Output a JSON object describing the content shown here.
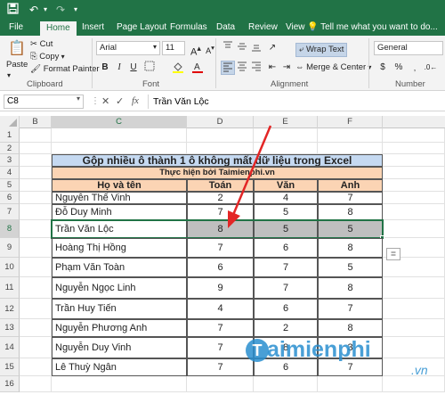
{
  "quick_access": {
    "save_icon": "save-icon",
    "undo_icon": "undo-icon",
    "redo_icon": "redo-icon"
  },
  "tabs": [
    "File",
    "Home",
    "Insert",
    "Page Layout",
    "Formulas",
    "Data",
    "Review",
    "View"
  ],
  "tell_me": "Tell me what you want to do...",
  "ribbon": {
    "paste": "Paste",
    "cut": "Cut",
    "copy": "Copy",
    "format_painter": "Format Painter",
    "clipboard_label": "Clipboard",
    "font_name": "Arial",
    "font_size": "11",
    "font_label": "Font",
    "bold": "B",
    "italic": "I",
    "underline": "U",
    "wrap_text": "Wrap Text",
    "merge_center": "Merge & Center",
    "alignment_label": "Alignment",
    "number_format": "General",
    "currency": "$",
    "percent": "%",
    "number_label": "Number"
  },
  "formula_bar": {
    "name_box": "C8",
    "fx": "fx",
    "cancel": "✕",
    "enter": "✓",
    "formula": "Trần Văn Lộc"
  },
  "grid": {
    "columns": [
      "B",
      "C",
      "D",
      "E",
      "F"
    ],
    "rows": [
      "1",
      "2",
      "3",
      "4",
      "5",
      "6",
      "7",
      "8",
      "9",
      "10",
      "11",
      "12",
      "13",
      "14",
      "15",
      "16"
    ],
    "title": "Gộp nhiều ô thành 1 ô không mất dữ liệu trong Excel",
    "subtitle": "Thực hiện bởi Taimienphi.vn",
    "headers": [
      "Họ và tên",
      "Toán",
      "Văn",
      "Anh"
    ],
    "data": [
      [
        "Nguyễn Thế Vinh",
        "2",
        "4",
        "7"
      ],
      [
        "Đỗ Duy Minh",
        "7",
        "5",
        "8"
      ],
      [
        "Trần Văn Lộc",
        "8",
        "5",
        "5"
      ],
      [
        "Hoàng Thị Hồng",
        "7",
        "6",
        "8"
      ],
      [
        "Phạm Văn Toàn",
        "6",
        "7",
        "5"
      ],
      [
        "Nguyễn Ngọc Linh",
        "9",
        "7",
        "8"
      ],
      [
        "Trần Huy Tiến",
        "4",
        "6",
        "7"
      ],
      [
        "Nguyễn Phương Anh",
        "7",
        "2",
        "8"
      ],
      [
        "Nguyễn Duy Vinh",
        "7",
        "8",
        "3"
      ],
      [
        "Lê Thuỳ Ngân",
        "7",
        "6",
        "7"
      ]
    ]
  },
  "watermark": {
    "main": "aimienphi",
    "sub": ".vn"
  },
  "colors": {
    "excel_green": "#217346",
    "title_fill": "#c5d9f1",
    "header_fill": "#fbd4b4",
    "selection": "#bfbfbf",
    "arrow": "#e32626"
  }
}
